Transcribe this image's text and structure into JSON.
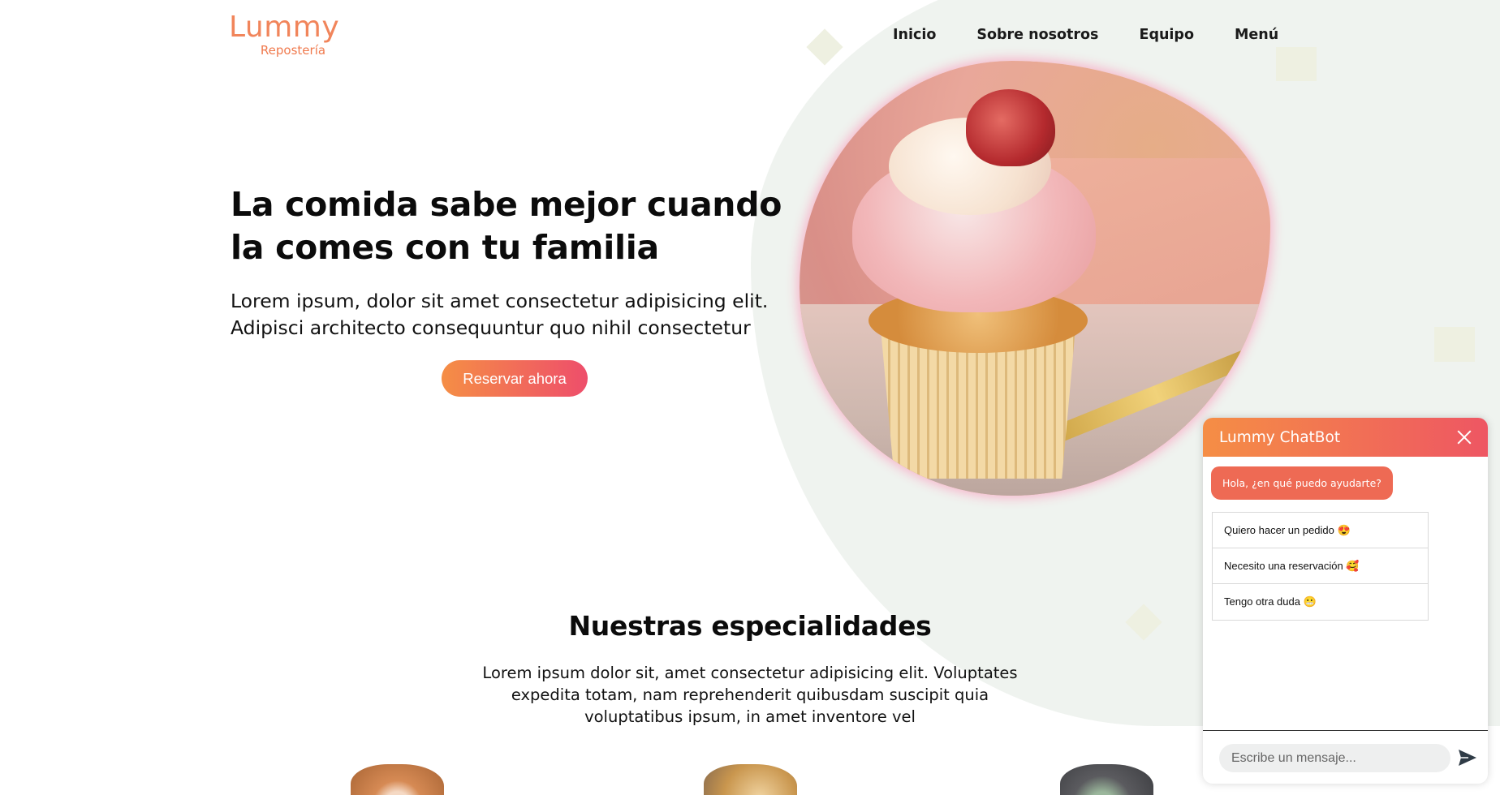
{
  "brand": {
    "name": "Lummy",
    "subtitle": "Repostería"
  },
  "nav": {
    "items": [
      "Inicio",
      "Sobre nosotros",
      "Equipo",
      "Menú"
    ]
  },
  "hero": {
    "title": "La comida sabe mejor cuando la comes con tu familia",
    "text": "Lorem ipsum, dolor sit amet consectetur adipisicing elit. Adipisci architecto consequuntur quo nihil consectetur",
    "button_label": "Reservar ahora"
  },
  "specialties": {
    "title": "Nuestras especialidades",
    "text": "Lorem ipsum dolor sit, amet consectetur adipisicing elit. Voluptates expedita totam, nam reprehenderit quibusdam suscipit quia voluptatibus ipsum, in amet inventore vel"
  },
  "chatbot": {
    "title": "Lummy ChatBot",
    "bot_message": "Hola, ¿en qué puedo ayudarte?",
    "options": [
      "Quiero hacer un pedido 😍",
      "Necesito una reservación 🥰",
      "Tengo otra duda 😬"
    ],
    "input_placeholder": "Escribe un mensaje..."
  },
  "colors": {
    "accent_orange": "#f58e45",
    "accent_pink": "#ee4e6b",
    "background_blob": "#eff3ef"
  }
}
